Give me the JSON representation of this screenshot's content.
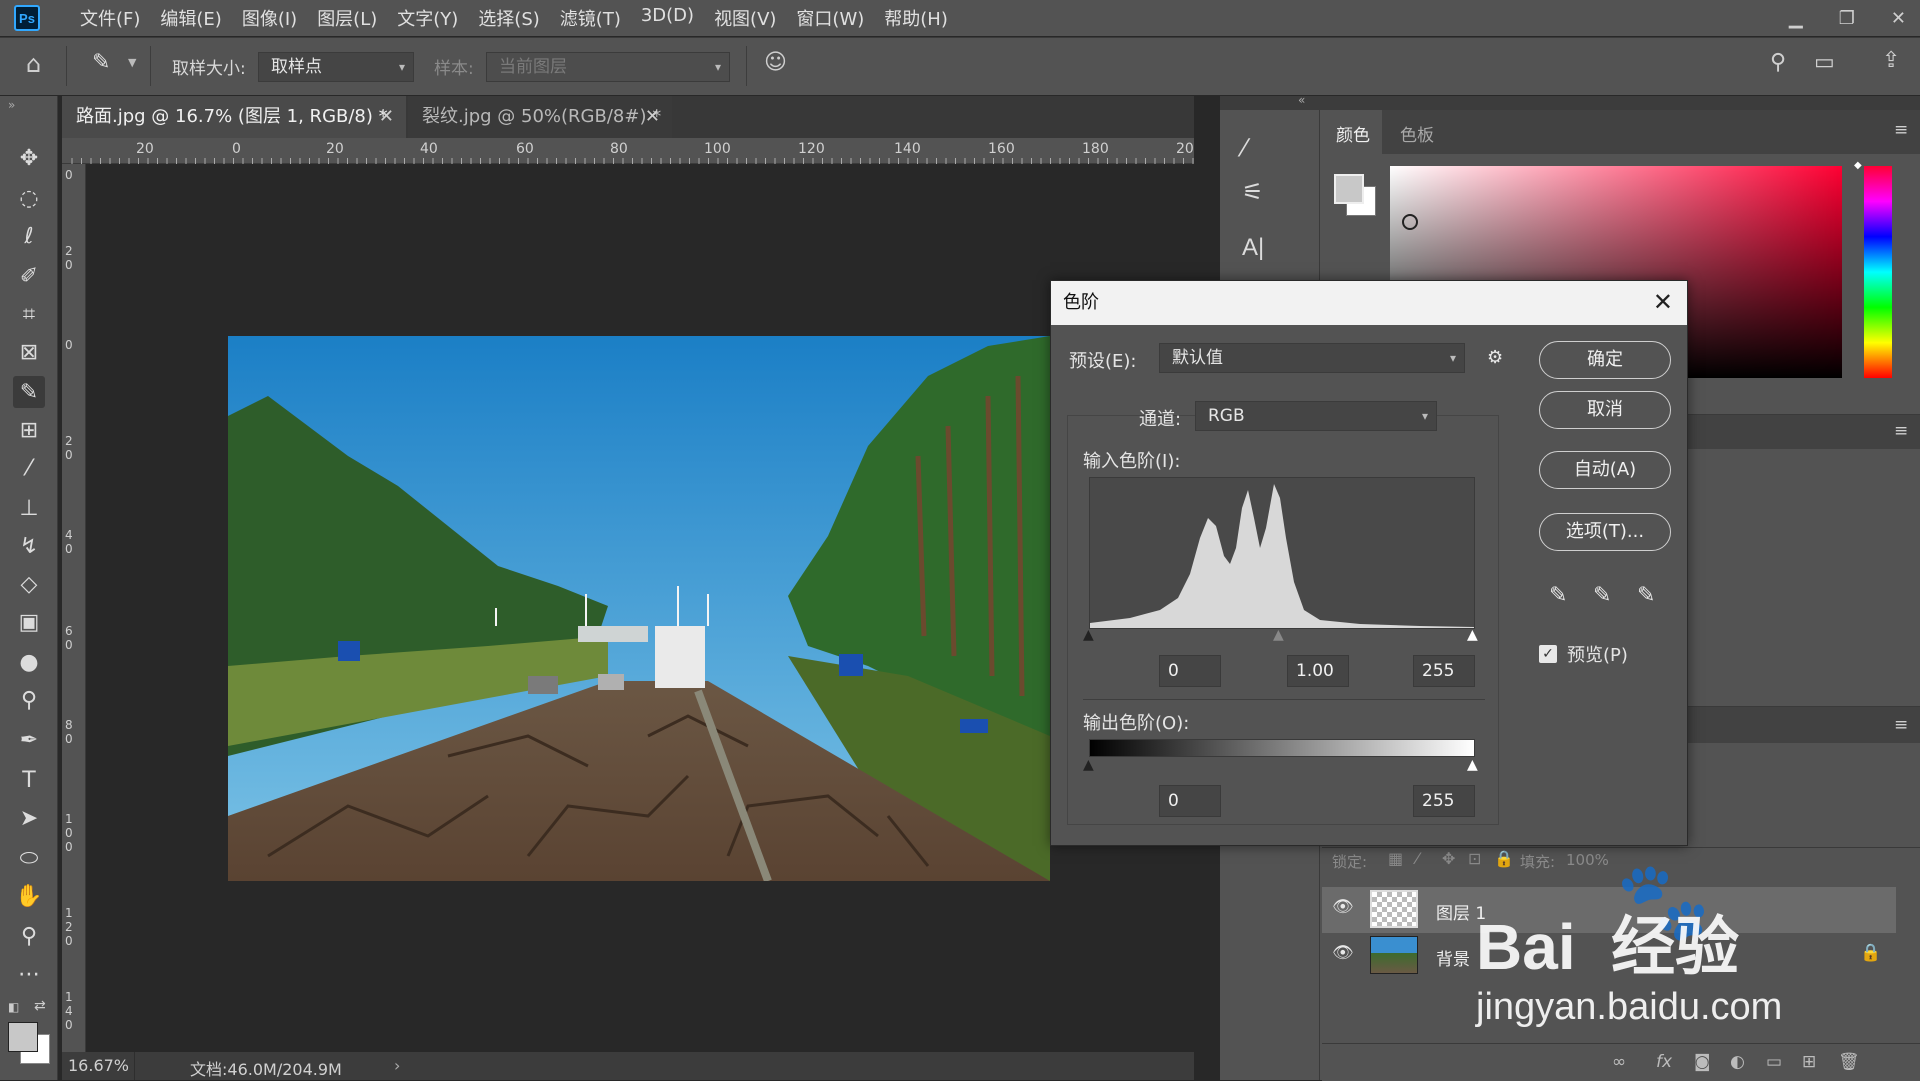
{
  "app": {
    "logo": "Ps"
  },
  "menubar": {
    "items": [
      "文件(F)",
      "编辑(E)",
      "图像(I)",
      "图层(L)",
      "文字(Y)",
      "选择(S)",
      "滤镜(T)",
      "3D(D)",
      "视图(V)",
      "窗口(W)",
      "帮助(H)"
    ]
  },
  "optionsbar": {
    "sample_size_label": "取样大小:",
    "sample_size_value": "取样点",
    "sample_label": "样本:",
    "sample_value": "当前图层"
  },
  "tabs": [
    {
      "label": "路面.jpg @ 16.7% (图层 1, RGB/8) *",
      "active": true
    },
    {
      "label": "裂纹.jpg @ 50%(RGB/8#) *",
      "active": false
    }
  ],
  "ruler": {
    "h_labels": [
      "20",
      "0",
      "20",
      "40",
      "60",
      "80",
      "100",
      "120",
      "140",
      "160",
      "180",
      "20"
    ],
    "v_labels": [
      "0",
      "2 0",
      "0",
      "2 0",
      "4 0",
      "6 0",
      "8 0",
      "1 0 0",
      "1 2 0",
      "1 4 0"
    ]
  },
  "status": {
    "zoom": "16.67%",
    "doc": "文档:46.0M/204.9M"
  },
  "color_panel": {
    "tab_color": "颜色",
    "tab_swatches": "色板"
  },
  "levels_dialog": {
    "title": "色阶",
    "preset_label": "预设(E):",
    "preset_value": "默认值",
    "channel_label": "通道:",
    "channel_value": "RGB",
    "input_label": "输入色阶(I):",
    "input_black": "0",
    "input_gamma": "1.00",
    "input_white": "255",
    "output_label": "输出色阶(O):",
    "output_black": "0",
    "output_white": "255",
    "ok": "确定",
    "cancel": "取消",
    "auto": "自动(A)",
    "options": "选项(T)...",
    "preview_label": "预览(P)",
    "preview_checked": true
  },
  "layers_panel": {
    "lock_label": "锁定:",
    "fill_label": "填充:",
    "fill_value": "100%",
    "layers": [
      {
        "name": "图层 1",
        "selected": true
      },
      {
        "name": "背景",
        "selected": false,
        "locked": true
      }
    ]
  },
  "watermark": {
    "brand": "Bai  经验",
    "url": "jingyan.baidu.com"
  }
}
